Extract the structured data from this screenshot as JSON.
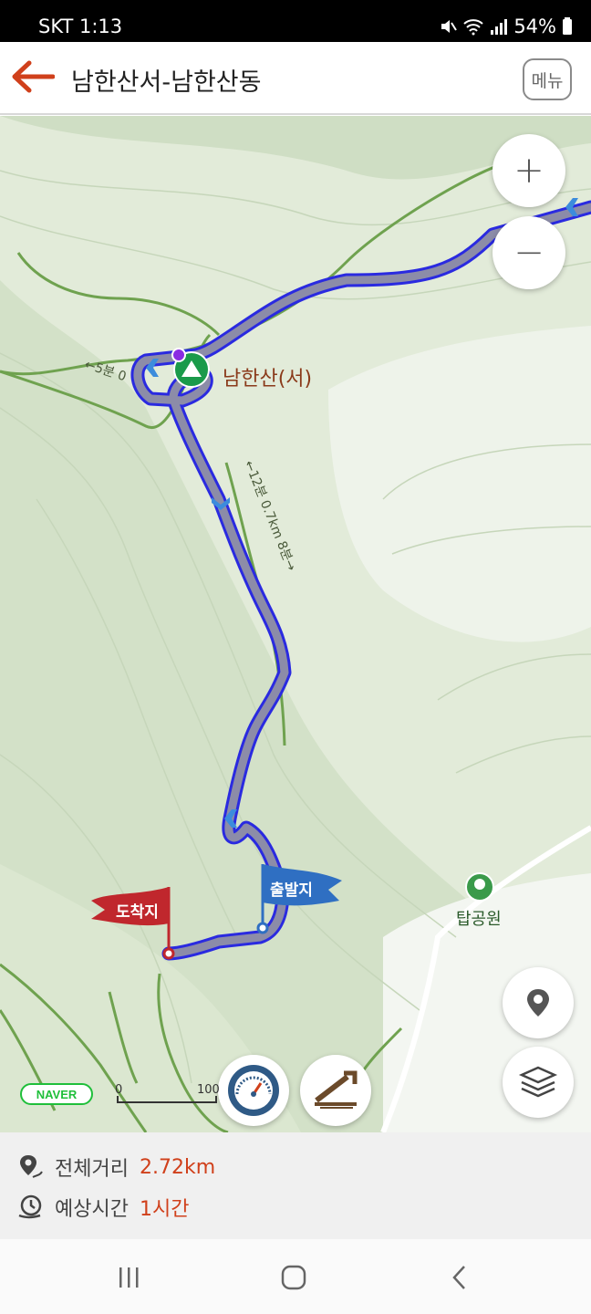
{
  "status": {
    "carrier_time": "SKT 1:13",
    "battery": "54%"
  },
  "header": {
    "title": "남한산서-남한산동",
    "menu_label": "메뉴"
  },
  "map": {
    "peak_label": "남한산(서)",
    "trail_label_main": "←12분 0.7km 8분→",
    "trail_label_side": "←5분 0",
    "start_flag": "출발지",
    "end_flag": "도착지",
    "park_label": "탑공원",
    "naver_logo": "NAVER",
    "scale_zero": "0",
    "scale_max": "100",
    "zoom_in": "+",
    "zoom_out": "−"
  },
  "info": {
    "distance_label": "전체거리",
    "distance_value": "2.72km",
    "time_label": "예상시간",
    "time_value": "1시간"
  },
  "colors": {
    "accent": "#d0401b",
    "route_outer": "#2a2ae0",
    "route_inner": "#8c8ca8",
    "start_flag": "#2f6fc2",
    "end_flag": "#c0272d",
    "peak_green": "#1a9a4a"
  }
}
